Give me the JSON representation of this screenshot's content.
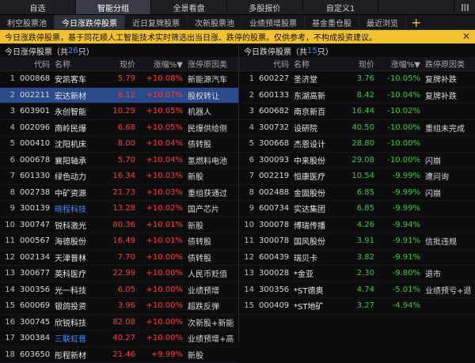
{
  "top_tabs": [
    "自选",
    "智能分组",
    "全景看盘",
    "多股报价",
    "自定义1",
    ""
  ],
  "top_active": 1,
  "sub_tabs": [
    "利空股票池",
    "今日涨跌停股票",
    "近日复牌股票",
    "次新股票池",
    "业绩预增股票",
    "基金重仓股",
    "最近浏览"
  ],
  "sub_active": 1,
  "sub_add": "+",
  "notice": {
    "text": "今日涨跌停股票，基于同花顺人工智能技术实时筛选出当日涨、跌停的股票。仅供参考，不构成投资建议。",
    "close": "✕"
  },
  "left_panel": {
    "title_prefix": "今日涨停股票（共",
    "count": "26",
    "title_suffix": "只）",
    "headers": [
      "",
      "代码",
      "名称",
      "现价",
      "涨幅%▼",
      "涨停原因类"
    ],
    "rows": [
      {
        "idx": "1",
        "code": "000868",
        "name": "安凯客车",
        "price": "5.79",
        "chg": "+10.08%",
        "reason": "新能源汽车"
      },
      {
        "idx": "2",
        "code": "002211",
        "name": "宏达新材",
        "price": "6.12",
        "chg": "+10.07%",
        "reason": "股权转让"
      },
      {
        "idx": "3",
        "code": "603901",
        "name": "永创智能",
        "price": "10.29",
        "chg": "+10.05%",
        "reason": "机器人"
      },
      {
        "idx": "4",
        "code": "002096",
        "name": "南岭民爆",
        "price": "6.68",
        "chg": "+10.05%",
        "reason": "民爆供给侧"
      },
      {
        "idx": "5",
        "code": "000410",
        "name": "沈阳机床",
        "price": "8.00",
        "chg": "+10.04%",
        "reason": "债转股"
      },
      {
        "idx": "6",
        "code": "000678",
        "name": "襄阳轴承",
        "price": "5.70",
        "chg": "+10.04%",
        "reason": "氢燃料电池"
      },
      {
        "idx": "7",
        "code": "601330",
        "name": "绿色动力",
        "price": "16.34",
        "chg": "+10.03%",
        "reason": "新股"
      },
      {
        "idx": "8",
        "code": "002738",
        "name": "中矿资源",
        "price": "21.73",
        "chg": "+10.03%",
        "reason": "重组获通过"
      },
      {
        "idx": "9",
        "code": "300139",
        "name": "晓程科技",
        "price": "13.28",
        "chg": "+10.02%",
        "reason": "国产芯片",
        "name_blue": true
      },
      {
        "idx": "10",
        "code": "300747",
        "name": "锐科激光",
        "price": "80.36",
        "chg": "+10.01%",
        "reason": "新股"
      },
      {
        "idx": "11",
        "code": "000567",
        "name": "海德股份",
        "price": "16.49",
        "chg": "+10.01%",
        "reason": "债转股"
      },
      {
        "idx": "12",
        "code": "002134",
        "name": "天津普林",
        "price": "7.70",
        "chg": "+10.00%",
        "reason": "债转股"
      },
      {
        "idx": "13",
        "code": "300677",
        "name": "英科医疗",
        "price": "22.99",
        "chg": "+10.00%",
        "reason": "人民币贬值"
      },
      {
        "idx": "14",
        "code": "300356",
        "name": "光一科技",
        "price": "6.05",
        "chg": "+10.00%",
        "reason": "业绩预增"
      },
      {
        "idx": "15",
        "code": "600069",
        "name": "银鸽投资",
        "price": "3.96",
        "chg": "+10.00%",
        "reason": "超跌反弹"
      },
      {
        "idx": "16",
        "code": "300745",
        "name": "欣锐科技",
        "price": "82.08",
        "chg": "+10.00%",
        "reason": "次新股+新能"
      },
      {
        "idx": "17",
        "code": "300384",
        "name": "三联虹普",
        "price": "40.27",
        "chg": "+10.00%",
        "reason": "业绩预增+高",
        "name_blue": true
      },
      {
        "idx": "18",
        "code": "603650",
        "name": "彤程新材",
        "price": "21.46",
        "chg": "+9.99%",
        "reason": "新股"
      }
    ]
  },
  "right_panel": {
    "title_prefix": "今日跌停股票（共",
    "count": "15",
    "title_suffix": "只）",
    "headers": [
      "",
      "代码",
      "名称",
      "现价",
      "涨幅%▼",
      "跌停原因类"
    ],
    "rows": [
      {
        "idx": "1",
        "code": "600227",
        "name": "圣济堂",
        "price": "3.76",
        "chg": "-10.05%",
        "reason": "复牌补跌"
      },
      {
        "idx": "2",
        "code": "600133",
        "name": "东湖高新",
        "price": "8.42",
        "chg": "-10.04%",
        "reason": "复牌补跌"
      },
      {
        "idx": "3",
        "code": "600682",
        "name": "南京新百",
        "price": "16.44",
        "chg": "-10.02%",
        "reason": ""
      },
      {
        "idx": "4",
        "code": "300732",
        "name": "设研院",
        "price": "40.50",
        "chg": "-10.00%",
        "reason": "重组未完成"
      },
      {
        "idx": "5",
        "code": "300668",
        "name": "杰恩设计",
        "price": "28.80",
        "chg": "-10.00%",
        "reason": ""
      },
      {
        "idx": "6",
        "code": "300093",
        "name": "中来股份",
        "price": "29.08",
        "chg": "-10.00%",
        "reason": "闪崩"
      },
      {
        "idx": "7",
        "code": "002219",
        "name": "恒康医疗",
        "price": "10.54",
        "chg": "-9.99%",
        "reason": "遭问询"
      },
      {
        "idx": "8",
        "code": "002488",
        "name": "金固股份",
        "price": "6.85",
        "chg": "-9.99%",
        "reason": "闪崩"
      },
      {
        "idx": "9",
        "code": "600734",
        "name": "实达集团",
        "price": "6.85",
        "chg": "-9.99%",
        "reason": ""
      },
      {
        "idx": "10",
        "code": "300078",
        "name": "博瑞传播",
        "price": "4.26",
        "chg": "-9.94%",
        "reason": ""
      },
      {
        "idx": "11",
        "code": "300078",
        "name": "国风股份",
        "price": "3.91",
        "chg": "-9.91%",
        "reason": "信批违规"
      },
      {
        "idx": "12",
        "code": "600439",
        "name": "瑞贝卡",
        "price": "3.82",
        "chg": "-9.91%",
        "reason": ""
      },
      {
        "idx": "13",
        "code": "300028",
        "name": "*金亚",
        "price": "2.30",
        "chg": "-9.80%",
        "reason": "退市"
      },
      {
        "idx": "14",
        "code": "300356",
        "name": "*ST德奥",
        "price": "4.74",
        "chg": "-5.01%",
        "reason": "业绩预亏+退"
      },
      {
        "idx": "15",
        "code": "000409",
        "name": "*ST地矿",
        "price": "3.27",
        "chg": "-4.94%",
        "reason": ""
      }
    ]
  },
  "colors": {
    "rise": "#ff3b3b",
    "fall": "#39c939",
    "accent": "#f2c230",
    "link": "#3b8cff",
    "selected_row": "#2b4a8a"
  }
}
